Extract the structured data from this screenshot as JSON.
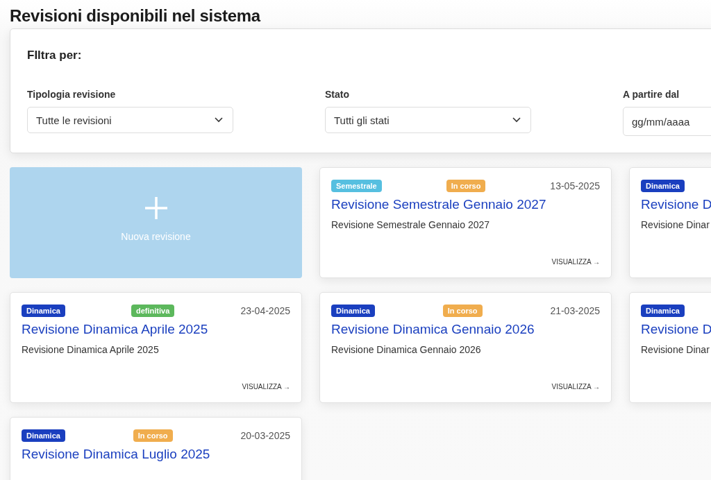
{
  "page_title": "Revisioni disponibili nel sistema",
  "filters": {
    "title": "FIltra per:",
    "fields": [
      {
        "kind": "select",
        "label": "Tipologia revisione",
        "value": "Tutte le revisioni"
      },
      {
        "kind": "select",
        "label": "Stato",
        "value": "Tutti gli stati"
      },
      {
        "kind": "date",
        "label": "A partire dal",
        "placeholder": "gg/mm/aaaa"
      }
    ]
  },
  "cards": [
    {
      "kind": "new",
      "label": "Nuova revisione"
    },
    {
      "kind": "revision",
      "type": {
        "label": "Semestrale",
        "color": "#56bfe0"
      },
      "status": {
        "label": "In corso",
        "color": "#f0ad4e"
      },
      "date": "13-05-2025",
      "title": "Revisione Semestrale Gennaio 2027",
      "description": "Revisione Semestrale Gennaio 2027",
      "link": "VISUALIZZA →"
    },
    {
      "kind": "revision",
      "type": {
        "label": "Dinamica",
        "color": "#1a3fbf"
      },
      "title": "Revisione D",
      "description": "Revisione Dinar"
    },
    {
      "kind": "revision",
      "type": {
        "label": "Dinamica",
        "color": "#1a3fbf"
      },
      "status": {
        "label": "definitiva",
        "color": "#5cb85c"
      },
      "date": "23-04-2025",
      "title": "Revisione Dinamica Aprile 2025",
      "description": "Revisione Dinamica Aprile 2025",
      "link": "VISUALIZZA →"
    },
    {
      "kind": "revision",
      "type": {
        "label": "Dinamica",
        "color": "#1a3fbf"
      },
      "status": {
        "label": "In corso",
        "color": "#f0ad4e"
      },
      "date": "21-03-2025",
      "title": "Revisione Dinamica Gennaio 2026",
      "description": "Revisione Dinamica Gennaio 2026",
      "link": "VISUALIZZA →"
    },
    {
      "kind": "revision",
      "type": {
        "label": "Dinamica",
        "color": "#1a3fbf"
      },
      "title": "Revisione D",
      "description": "Revisione Dinar"
    },
    {
      "kind": "revision",
      "type": {
        "label": "Dinamica",
        "color": "#1a3fbf"
      },
      "status": {
        "label": "In corso",
        "color": "#f0ad4e"
      },
      "date": "20-03-2025",
      "title": "Revisione Dinamica Luglio 2025"
    }
  ]
}
